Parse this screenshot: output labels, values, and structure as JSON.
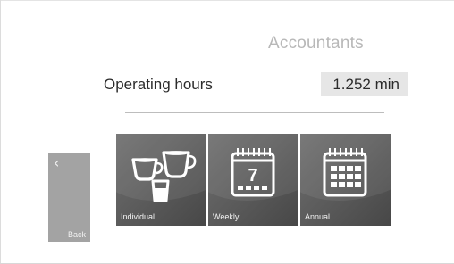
{
  "header": {
    "title": "Accountants"
  },
  "operating_hours": {
    "label": "Operating hours",
    "value": "1.252 min"
  },
  "back_button": {
    "label": "Back",
    "icon": "chevron-left-icon"
  },
  "tiles": [
    {
      "label": "Individual",
      "icon": "cups-icon"
    },
    {
      "label": "Weekly",
      "icon": "calendar-week-icon",
      "icon_text": "7"
    },
    {
      "label": "Annual",
      "icon": "calendar-grid-icon"
    }
  ],
  "colors": {
    "background": "#ffffff",
    "title": "#b8b8b8",
    "text": "#2b2b2b",
    "value_box": "#e6e6e6",
    "tile": "#5e5e5e",
    "back_button": "#a3a3a3",
    "divider": "#bdbdbd"
  }
}
